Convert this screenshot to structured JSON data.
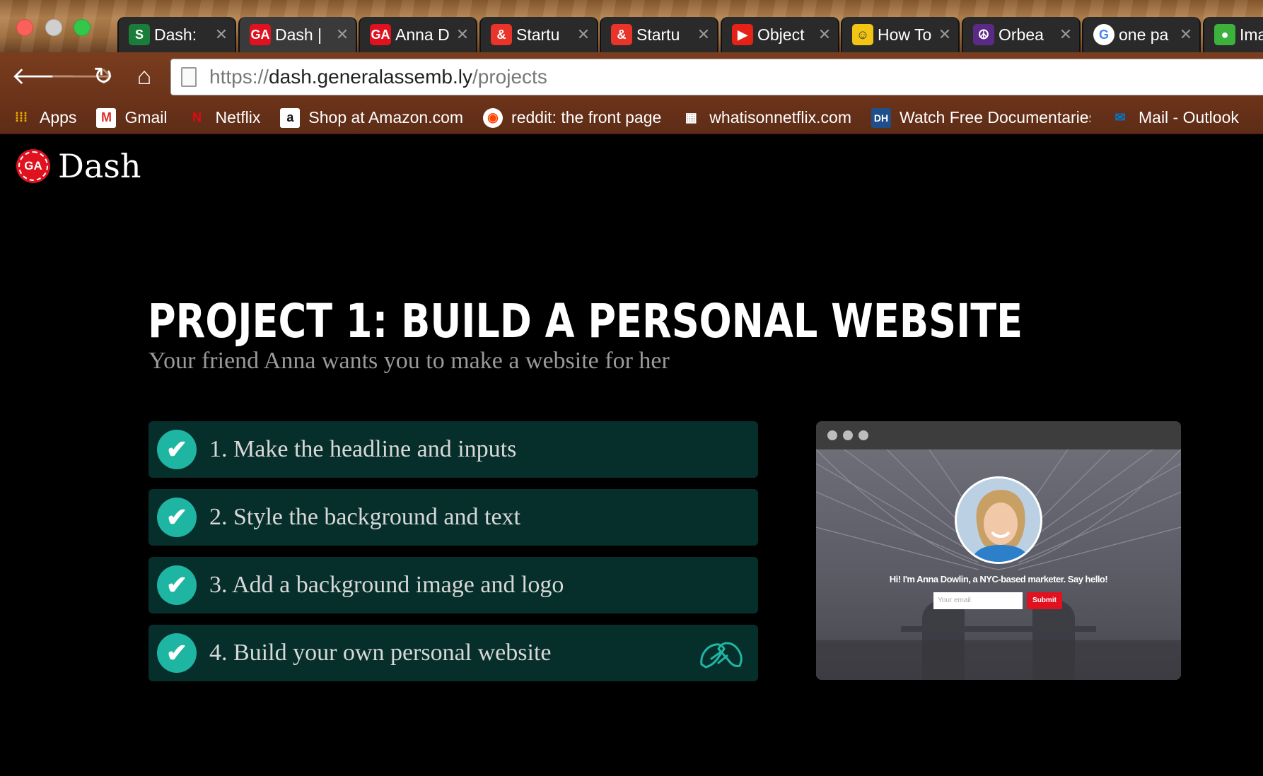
{
  "browser": {
    "tabs": [
      {
        "title": "Dash:",
        "favicon": "S",
        "favicon_color": "#1b7d3a",
        "favicon_name": "s-favicon-icon"
      },
      {
        "title": "Dash |",
        "favicon": "GA",
        "favicon_color": "#e0121f",
        "favicon_name": "ga-favicon-icon",
        "active": true
      },
      {
        "title": "Anna D",
        "favicon": "GA",
        "favicon_color": "#e0121f",
        "favicon_name": "ga-favicon-icon"
      },
      {
        "title": "Startu",
        "favicon": "&",
        "favicon_color": "#e8342a",
        "favicon_name": "ampersand-favicon-icon"
      },
      {
        "title": "Startu",
        "favicon": "&",
        "favicon_color": "#e8342a",
        "favicon_name": "ampersand-favicon-icon"
      },
      {
        "title": "Object",
        "favicon": "▶",
        "favicon_color": "#e62117",
        "favicon_name": "youtube-favicon-icon"
      },
      {
        "title": "How To",
        "favicon": "☺",
        "favicon_color": "#f2c514",
        "favicon_name": "smiley-favicon-icon"
      },
      {
        "title": "Orbea",
        "favicon": "☮",
        "favicon_color": "#5b2a86",
        "favicon_name": "peace-favicon-icon"
      },
      {
        "title": "one pa",
        "favicon": "G",
        "favicon_color": "#ffffff",
        "favicon_name": "google-favicon-icon"
      },
      {
        "title": "Ima",
        "favicon": "●",
        "favicon_color": "#3cb13c",
        "favicon_name": "green-dot-favicon-icon"
      }
    ],
    "tab_close_glyph": "✕",
    "url": {
      "scheme": "https://",
      "host": "dash.generalassemb.ly",
      "path": "/projects"
    },
    "bookmarks": [
      {
        "label": "Apps",
        "icon": "apps-grid-icon",
        "glyph": "⁞⁞⁞",
        "color": "#f4b400"
      },
      {
        "label": "Gmail",
        "icon": "gmail-icon",
        "glyph": "M",
        "color": "#d93025"
      },
      {
        "label": "Netflix",
        "icon": "netflix-icon",
        "glyph": "N",
        "color": "#e50914"
      },
      {
        "label": "Shop at Amazon.com",
        "icon": "amazon-icon",
        "glyph": "a",
        "color": "#ffffff"
      },
      {
        "label": "reddit: the front page",
        "icon": "reddit-icon",
        "glyph": "◉",
        "color": "#ffffff"
      },
      {
        "label": "whatisonnetflix.com",
        "icon": "film-icon",
        "glyph": "▦",
        "color": "#ffffff"
      },
      {
        "label": "Watch Free Documentaries",
        "icon": "dh-icon",
        "glyph": "DH",
        "color": "#1f4f8b"
      },
      {
        "label": "Mail - Outlook",
        "icon": "mail-icon",
        "glyph": "✉",
        "color": "#0078d4"
      }
    ]
  },
  "page": {
    "brand": {
      "logo_text": "GA",
      "name": "Dash"
    },
    "title": "PROJECT 1: BUILD A PERSONAL WEBSITE",
    "subtitle": "Your friend Anna wants you to make a website for her",
    "steps": [
      {
        "label": "1. Make the headline and inputs",
        "completed": true
      },
      {
        "label": "2. Style the background and text",
        "completed": true
      },
      {
        "label": "3. Add a background image and logo",
        "completed": true
      },
      {
        "label": "4. Build your own personal website",
        "completed": true
      }
    ],
    "check_glyph": "✔",
    "preview": {
      "caption": "Hi! I'm Anna Dowlin, a NYC-based marketer. Say hello!",
      "input_placeholder": "Your email",
      "submit_label": "Submit"
    }
  },
  "colors": {
    "accent_teal": "#1fb5a3",
    "step_bg": "#062f2b",
    "brand_red": "#e0121f"
  }
}
